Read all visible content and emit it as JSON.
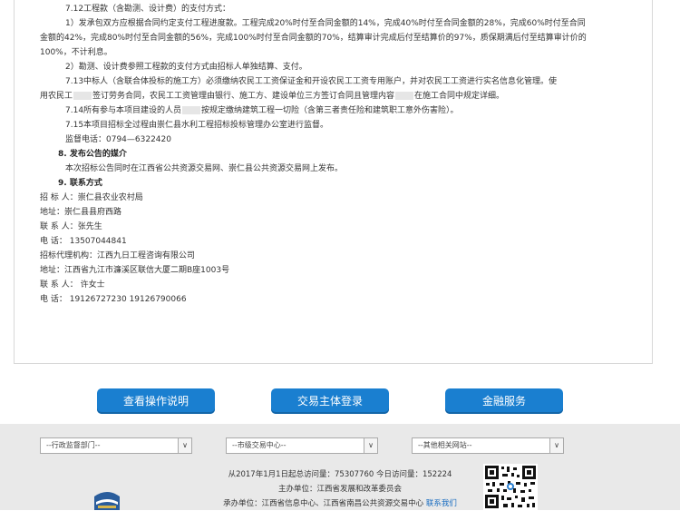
{
  "doc": {
    "l1": "7.12工程款（含勘测、设计费）的支付方式：",
    "l2": "1）发承包双方应根据合同约定支付工程进度款。工程完成20%时付至合同金额的14%，完成40%时付至合同金额的28%，完成60%时付至合同",
    "l3": "金额的42%，完成80%时付至合同金额的56%，完成100%时付至合同金额的70%，结算审计完成后付至结算价的97%，质保期满后付至结算审计价的",
    "l4": "100%，不计利息。",
    "l5": "2）勘测、设计费参照工程款的支付方式由招标人单独结算、支付。",
    "l6": "7.13中标人（含联合体投标的施工方）必须缴纳农民工工资保证金和开设农民工工资专用账户，并对农民工工资进行实名信息化管理。使",
    "l7a": "用农民工",
    "l7b": "签订劳务合同，农民工工资管理由银行、施工方、建设单位三方签订合同且管理内容",
    "l7c": "在施工合同中规定详细。",
    "l8a": "7.14所有参与本项目建设的人员",
    "l8b": "按规定缴纳建筑工程一切险（含第三者责任险和建筑职工意外伤害险）。",
    "l9": "7.15本项目招标全过程由崇仁县水利工程招标投标管理办公室进行监督。",
    "l10": "监督电话：0794—6322420",
    "l11": "8.  发布公告的媒介",
    "l12": "本次招标公告同时在江西省公共资源交易网、崇仁县公共资源交易网上发布。",
    "l13": "9.  联系方式",
    "l14": "招 标 人：崇仁县农业农村局",
    "l15": "地址：崇仁县县府西路",
    "l16": "联 系 人：张先生",
    "l17": "电  话：   13507044841",
    "l18": "招标代理机构：江西九日工程咨询有限公司",
    "l19": "地址：江西省九江市濂溪区联信大厦二期B座1003号",
    "l20": "联 系 人：  许女士",
    "l21": "电  话：   19126727230  19126790066"
  },
  "buttons": {
    "guide": "查看操作说明",
    "login": "交易主体登录",
    "finance": "金融服务"
  },
  "footer": {
    "select1": "--行政监督部门--",
    "select2": "--市级交易中心--",
    "select3": "--其他相关网站--",
    "stats": "从2017年1月1日起总访问量：75307760 今日访问量：152224",
    "host": "主办单位：江西省发展和改革委员会",
    "undertake": "承办单位：江西省信息中心、江西省南昌公共资源交易中心",
    "contact": "联系我们"
  },
  "colors": {
    "button_blue": "#1a7fd0",
    "footer_bg": "#e9e9e9",
    "link": "#1a6dc0"
  }
}
